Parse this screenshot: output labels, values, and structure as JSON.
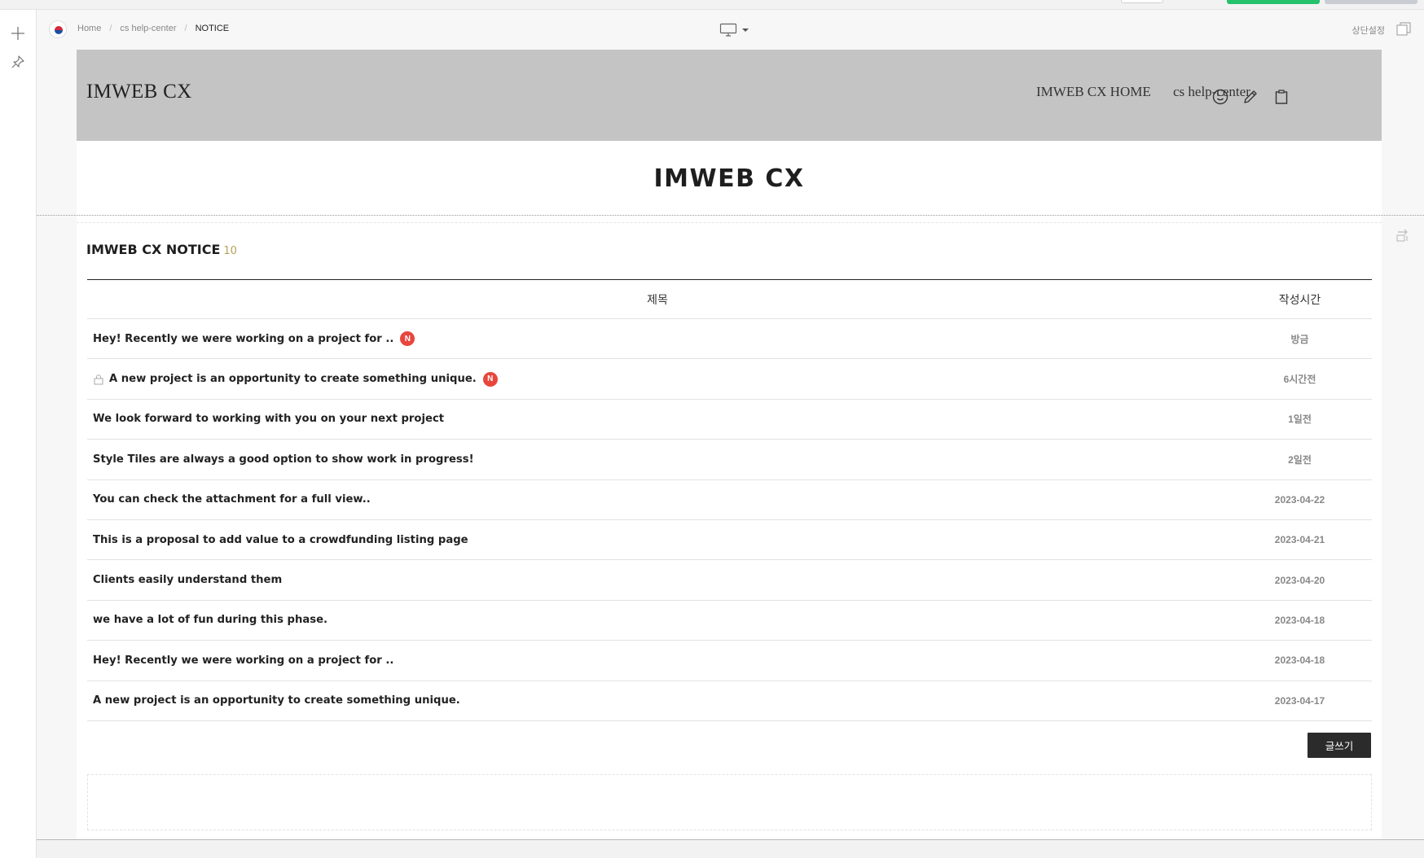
{
  "breadcrumb": {
    "home": "Home",
    "parent": "cs help-center",
    "current": "NOTICE",
    "separator": "/"
  },
  "toolbar": {
    "top_setting": "상단설정",
    "device": "desktop-icon"
  },
  "site": {
    "logo": "IMWEB CX",
    "nav": [
      "IMWEB CX HOME",
      "cs help-center"
    ],
    "title": "IMWEB CX"
  },
  "board": {
    "title": "IMWEB CX NOTICE",
    "count": "10",
    "headers": {
      "title": "제목",
      "date": "작성시간"
    },
    "rows": [
      {
        "title": "Hey! Recently we were working on a project for ..",
        "date": "방금",
        "is_new": true,
        "locked": false
      },
      {
        "title": "A new project is an opportunity to create something unique.",
        "date": "6시간전",
        "is_new": true,
        "locked": true
      },
      {
        "title": "We look forward to working with you on your next project",
        "date": "1일전",
        "is_new": false,
        "locked": false
      },
      {
        "title": "Style Tiles are always a good option to show work in progress!",
        "date": "2일전",
        "is_new": false,
        "locked": false
      },
      {
        "title": "You can check the attachment for a full view..",
        "date": "2023-04-22",
        "is_new": false,
        "locked": false
      },
      {
        "title": "This is a proposal to add value to a crowdfunding listing page",
        "date": "2023-04-21",
        "is_new": false,
        "locked": false
      },
      {
        "title": "Clients easily understand them",
        "date": "2023-04-20",
        "is_new": false,
        "locked": false
      },
      {
        "title": "we have a lot of fun during this phase.",
        "date": "2023-04-18",
        "is_new": false,
        "locked": false
      },
      {
        "title": "Hey! Recently we were working on a project for ..",
        "date": "2023-04-18",
        "is_new": false,
        "locked": false
      },
      {
        "title": "A new project is an opportunity to create something unique.",
        "date": "2023-04-17",
        "is_new": false,
        "locked": false
      }
    ],
    "new_badge": "N",
    "write_button": "글쓰기"
  },
  "colors": {
    "header_bg": "#c4c4c4",
    "new_badge": "#e8463c",
    "count": "#b4a15a",
    "write_button": "#2b2b2b",
    "publish_green": "#23c26b"
  }
}
